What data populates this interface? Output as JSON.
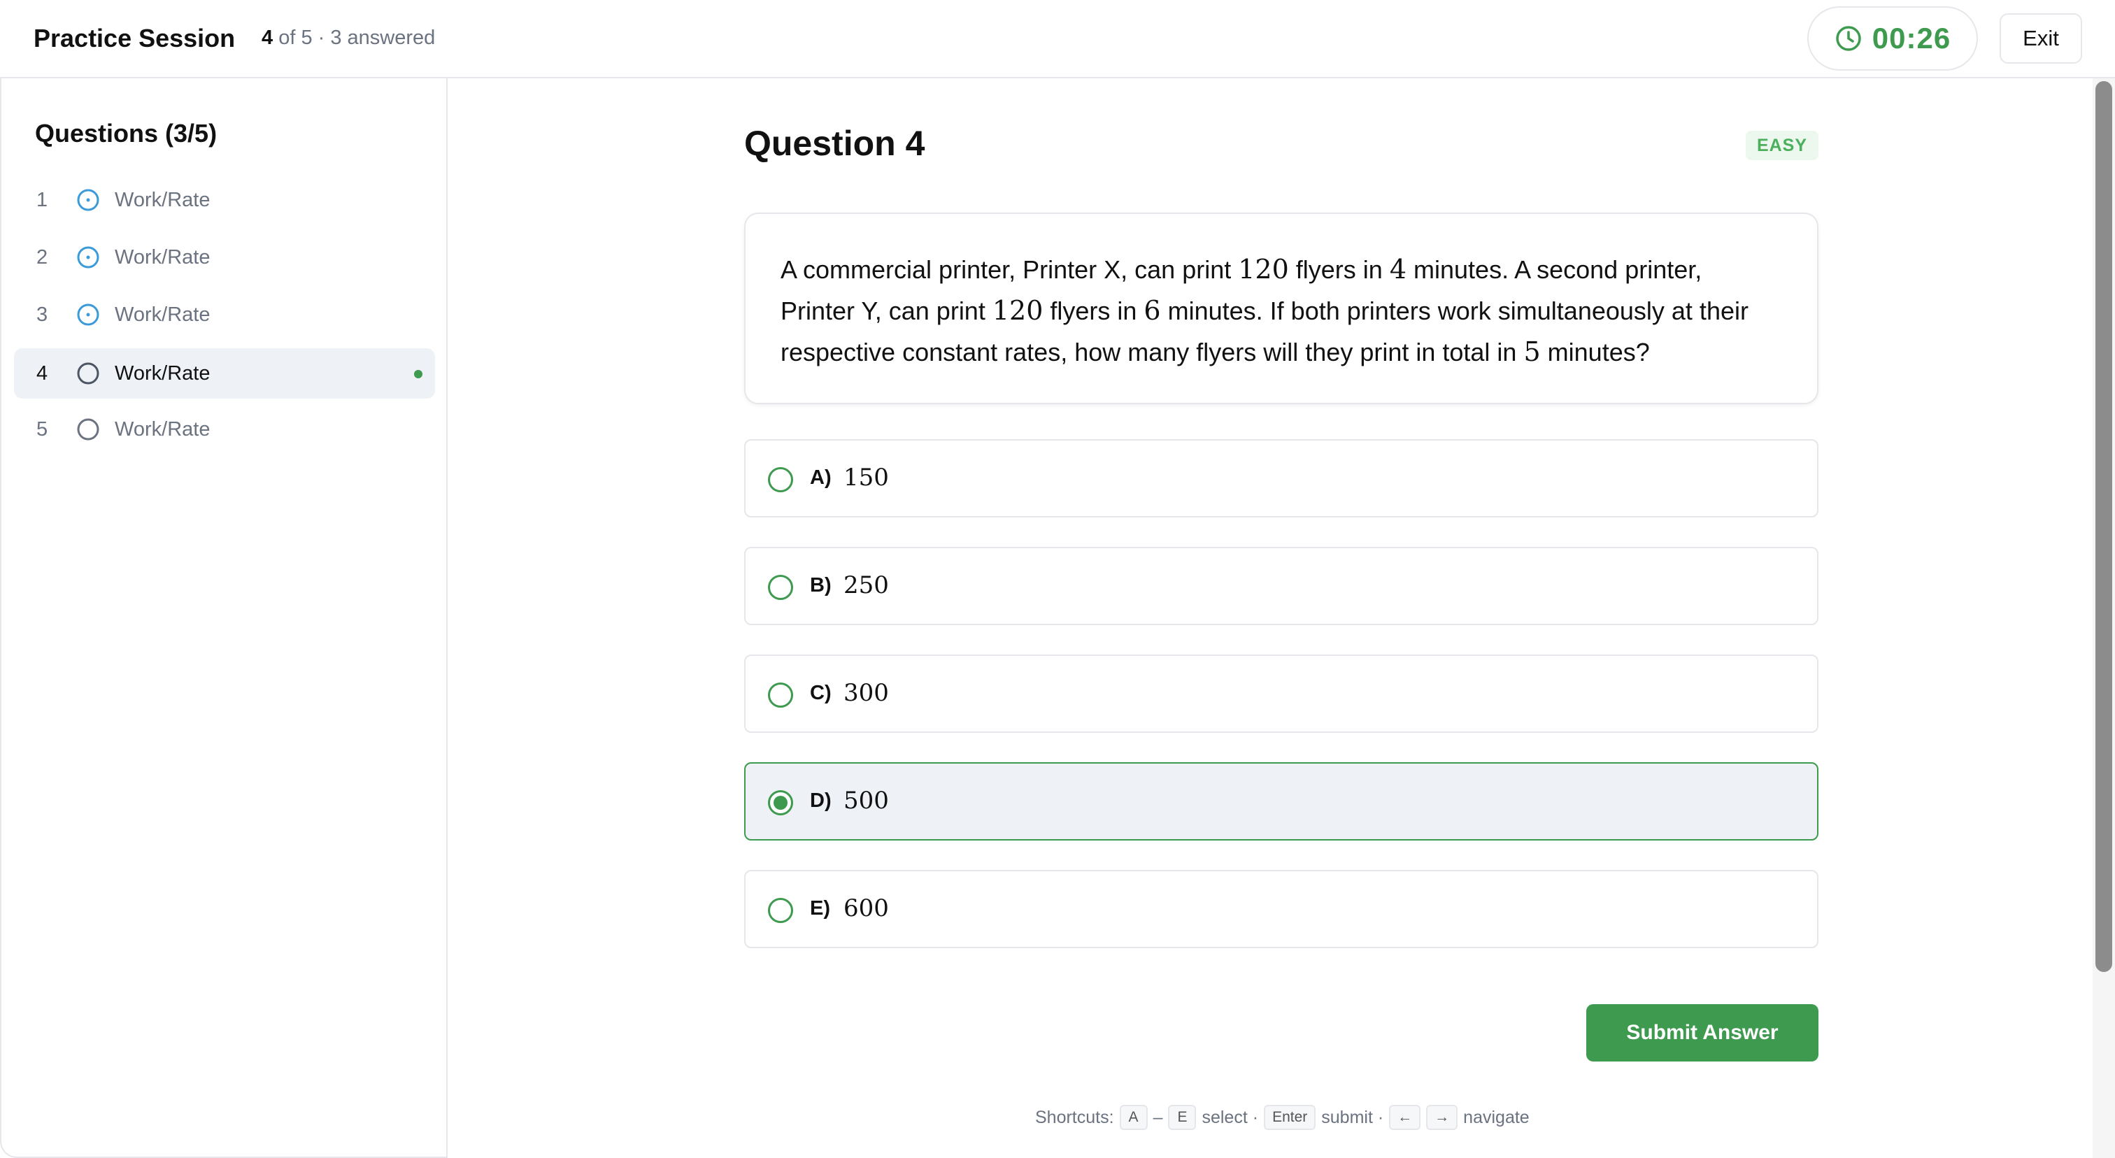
{
  "header": {
    "app_title": "Practice Session",
    "progress_current": "4",
    "progress_rest": "of 5 · 3 answered",
    "timer": "00:26",
    "exit_label": "Exit",
    "timer_icon": "clock-icon"
  },
  "sidebar": {
    "title": "Questions (3/5)",
    "items": [
      {
        "num": "1",
        "label": "Work/Rate",
        "status": "answered",
        "icon": "circle-dot-icon"
      },
      {
        "num": "2",
        "label": "Work/Rate",
        "status": "answered",
        "icon": "circle-dot-icon"
      },
      {
        "num": "3",
        "label": "Work/Rate",
        "status": "answered",
        "icon": "circle-dot-icon"
      },
      {
        "num": "4",
        "label": "Work/Rate",
        "status": "current",
        "icon": "circle-icon"
      },
      {
        "num": "5",
        "label": "Work/Rate",
        "status": "unanswered",
        "icon": "circle-icon"
      }
    ]
  },
  "question": {
    "heading": "Question 4",
    "difficulty": "EASY",
    "text": {
      "p1": "A commercial printer, Printer X, can print ",
      "n1": "120",
      "p2": " flyers in ",
      "n2": "4",
      "p3": " minutes. A second printer, Printer Y, can print ",
      "n3": "120",
      "p4": " flyers in ",
      "n4": "6",
      "p5": " minutes. If both printers work simultaneously at their respective constant rates, how many flyers will they print in total in ",
      "n5": "5",
      "p6": " minutes?"
    },
    "options": [
      {
        "letter": "A)",
        "value": "150",
        "selected": false
      },
      {
        "letter": "B)",
        "value": "250",
        "selected": false
      },
      {
        "letter": "C)",
        "value": "300",
        "selected": false
      },
      {
        "letter": "D)",
        "value": "500",
        "selected": true
      },
      {
        "letter": "E)",
        "value": "600",
        "selected": false
      }
    ],
    "submit_label": "Submit Answer"
  },
  "shortcuts": {
    "prefix": "Shortcuts:",
    "key_a": "A",
    "dash": "–",
    "key_e": "E",
    "select": "select ·",
    "key_enter": "Enter",
    "submit": "submit ·",
    "key_left": "←",
    "key_right": "→",
    "navigate": "navigate"
  },
  "colors": {
    "accent_green": "#3d9a4e",
    "answered_blue": "#3b9ad9",
    "easy_bg": "#ecf7ee"
  }
}
